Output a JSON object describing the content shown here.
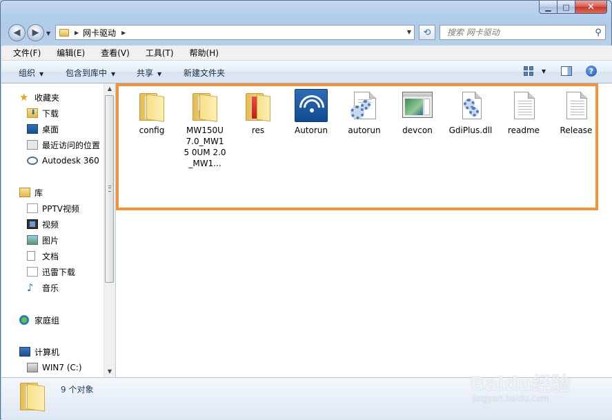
{
  "window": {
    "caption_buttons": [
      "minimize-button",
      "maximize-button",
      "close-button"
    ]
  },
  "address_bar": {
    "crumbs": [
      "网卡驱动"
    ]
  },
  "search": {
    "placeholder": "搜索 网卡驱动"
  },
  "menu": {
    "items": [
      "文件(F)",
      "编辑(E)",
      "查看(V)",
      "工具(T)",
      "帮助(H)"
    ]
  },
  "toolbar": {
    "organize": "组织",
    "include_in_library": "包含到库中",
    "share": "共享",
    "new_folder": "新建文件夹"
  },
  "nav": {
    "favorites": {
      "label": "收藏夹",
      "items": [
        "下载",
        "桌面",
        "最近访问的位置",
        "Autodesk 360"
      ]
    },
    "libraries": {
      "label": "库",
      "items": [
        "PPTV视频",
        "视频",
        "图片",
        "文档",
        "迅雷下载",
        "音乐"
      ]
    },
    "homegroup": "家庭组",
    "computer": {
      "label": "计算机",
      "items": [
        "WIN7 (C:)"
      ]
    }
  },
  "files": [
    {
      "name": "config",
      "icon": "folder-icon"
    },
    {
      "name": "MW150U 7.0_MW15 0UM 2.0_MW1...",
      "icon": "folder-with-setup-icon"
    },
    {
      "name": "res",
      "icon": "folder-with-image-icon"
    },
    {
      "name": "Autorun",
      "icon": "autorun-wireless-icon"
    },
    {
      "name": "autorun",
      "icon": "settings-file-icon"
    },
    {
      "name": "devcon",
      "icon": "application-window-icon"
    },
    {
      "name": "GdiPlus.dll",
      "icon": "dll-gear-icon"
    },
    {
      "name": "readme",
      "icon": "text-document-icon"
    },
    {
      "name": "Release",
      "icon": "text-document-icon"
    }
  ],
  "status": {
    "count_text": "9 个对象"
  },
  "watermark": {
    "brand": "Baidu经验",
    "site": "jingyan.baidu.com"
  },
  "colors": {
    "highlight_border": "#f39237",
    "window_chrome": "#b9d1ea"
  }
}
